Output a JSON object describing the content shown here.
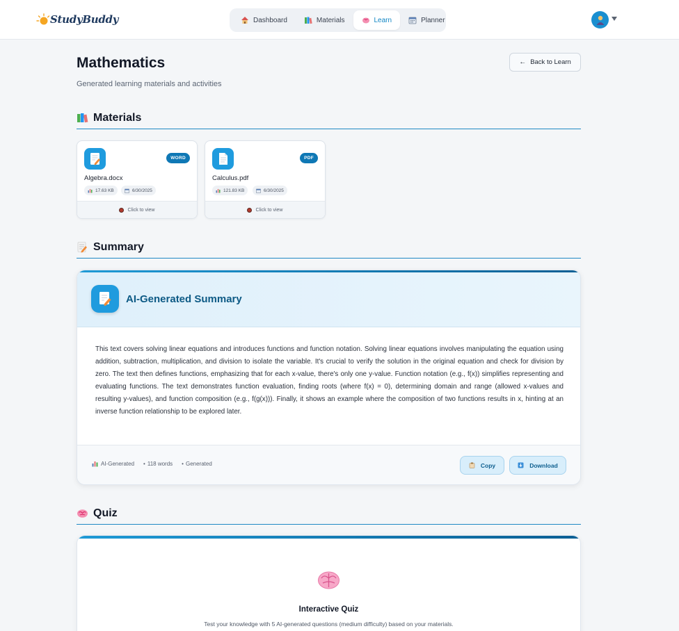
{
  "brand": {
    "name": "StudyBuddy"
  },
  "nav": {
    "items": [
      {
        "label": "Dashboard",
        "icon": "house-icon"
      },
      {
        "label": "Materials",
        "icon": "books-icon"
      },
      {
        "label": "Learn",
        "icon": "brain-icon",
        "active": true
      },
      {
        "label": "Planner",
        "icon": "calendar-icon"
      }
    ]
  },
  "page": {
    "title": "Mathematics",
    "subtitle": "Generated learning materials and activities",
    "back_label": "Back to Learn"
  },
  "sections": {
    "materials": "Materials",
    "summary": "Summary",
    "quiz": "Quiz"
  },
  "materials": [
    {
      "name": "Algebra.docx",
      "badge": "WORD",
      "size": "17.63 KB",
      "date": "6/30/2025",
      "action": "Click to view"
    },
    {
      "name": "Calculus.pdf",
      "badge": "PDF",
      "size": "121.83 KB",
      "date": "6/30/2025",
      "action": "Click to view"
    }
  ],
  "summary": {
    "title": "AI-Generated Summary",
    "body": "This text covers solving linear equations and introduces functions and function notation. Solving linear equations involves manipulating the equation using addition, subtraction, multiplication, and division to isolate the variable. It's crucial to verify the solution in the original equation and check for division by zero. The text then defines functions, emphasizing that for each x-value, there's only one y-value. Function notation (e.g., f(x)) simplifies representing and evaluating functions. The text demonstrates function evaluation, finding roots (where f(x) = 0), determining domain and range (allowed x-values and resulting y-values), and function composition (e.g., f(g(x))). Finally, it shows an example where the composition of two functions results in x, hinting at an inverse function relationship to be explored later.",
    "stat_source": "AI-Generated",
    "stat_words": "118 words",
    "stat_status": "Generated",
    "copy_label": "Copy",
    "download_label": "Download"
  },
  "quiz": {
    "title": "Interactive Quiz",
    "description": "Test your knowledge with 5 AI-generated questions (medium difficulty) based on your materials."
  },
  "colors": {
    "accent": "#1186c4",
    "accent_dark": "#0b5f94",
    "badge": "#0f78b5",
    "page_bg": "#f4f6f8"
  }
}
